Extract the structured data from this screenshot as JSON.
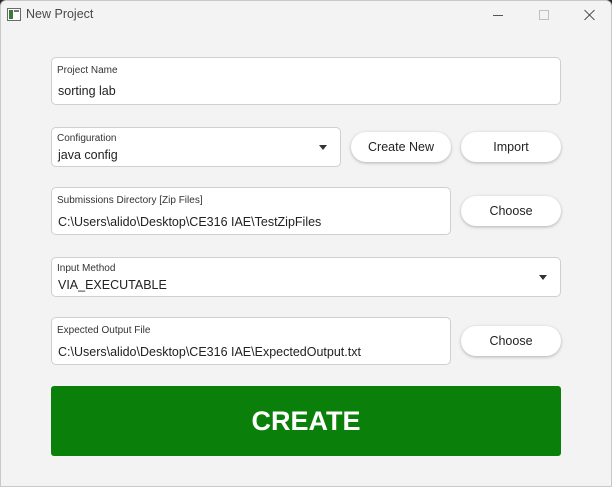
{
  "window": {
    "title": "New Project"
  },
  "project_name": {
    "label": "Project Name",
    "value": "sorting lab"
  },
  "configuration": {
    "label": "Configuration",
    "value": "java config",
    "create_new_label": "Create New",
    "import_label": "Import"
  },
  "submissions_dir": {
    "label": "Submissions Directory [Zip Files]",
    "value": "C:\\Users\\alido\\Desktop\\CE316 IAE\\TestZipFiles",
    "choose_label": "Choose"
  },
  "input_method": {
    "label": "Input Method",
    "value": "VIA_EXECUTABLE"
  },
  "expected_output": {
    "label": "Expected Output File",
    "value": "C:\\Users\\alido\\Desktop\\CE316 IAE\\ExpectedOutput.txt",
    "choose_label": "Choose"
  },
  "create_label": "CREATE",
  "colors": {
    "create_button": "#0a800a",
    "window_bg": "#f3f3f3"
  },
  "icons": {
    "app": "app-window-icon",
    "dropdown": "chevron-down-icon",
    "minimize": "minimize-icon",
    "maximize": "maximize-icon",
    "close": "close-icon"
  }
}
